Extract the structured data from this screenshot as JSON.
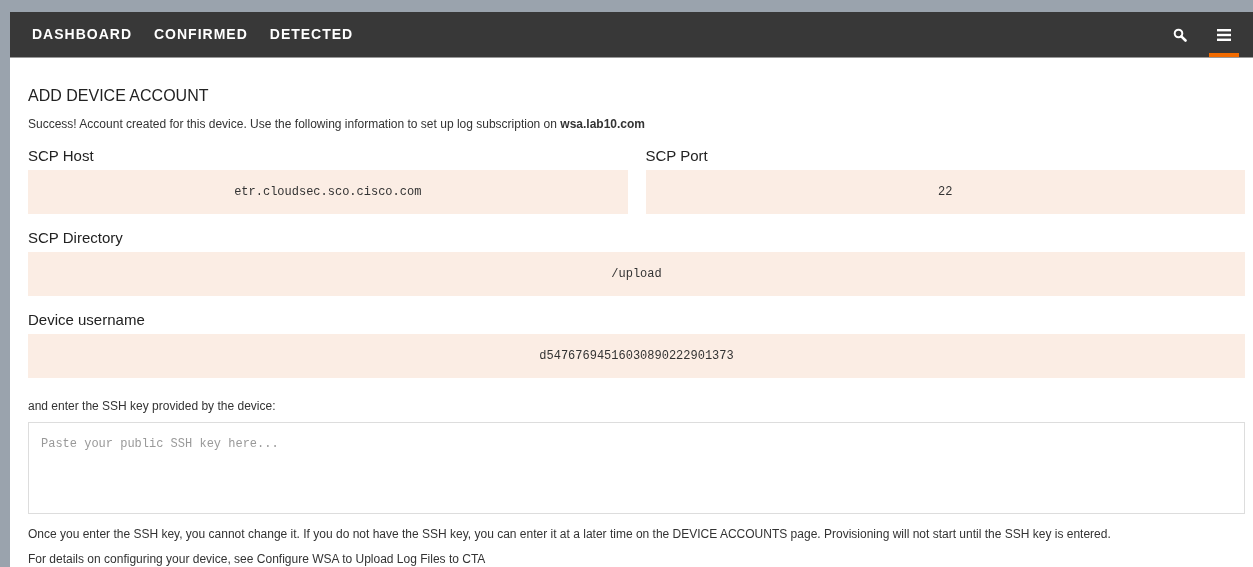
{
  "nav": {
    "links": [
      {
        "label": "DASHBOARD"
      },
      {
        "label": "CONFIRMED"
      },
      {
        "label": "DETECTED"
      }
    ],
    "icons": [
      {
        "kind": "search",
        "selected": false
      },
      {
        "kind": "menu",
        "selected": true
      }
    ]
  },
  "heading": "ADD DEVICE ACCOUNT",
  "success": "Success! Account created for this device. Use the following information to set up log subscription on **wsa.lab10.com**",
  "fields": [
    {
      "label": "SCP Host",
      "value": "etr.cloudsec.sco.cisco.com",
      "half": true
    },
    {
      "label": "SCP Port",
      "value": "22",
      "half": true
    },
    {
      "label": "SCP Directory",
      "value": "/upload",
      "half": false
    },
    {
      "label": "Device username",
      "value": "d54767694516030890222901373",
      "half": false
    }
  ],
  "ssh_prompt": "and enter the SSH key provided by the device:",
  "ssh_key": {
    "placeholder": "Paste your public SSH key here..."
  },
  "notes": [
    "Once you enter the SSH key, you cannot change it. If you do not have the SSH key, you can enter it at a later time on the DEVICE ACCOUNTS page. Provisioning will not start until the SSH key is entered.",
    "For details on configuring your device, see Configure WSA to Upload Log Files to CTA"
  ]
}
